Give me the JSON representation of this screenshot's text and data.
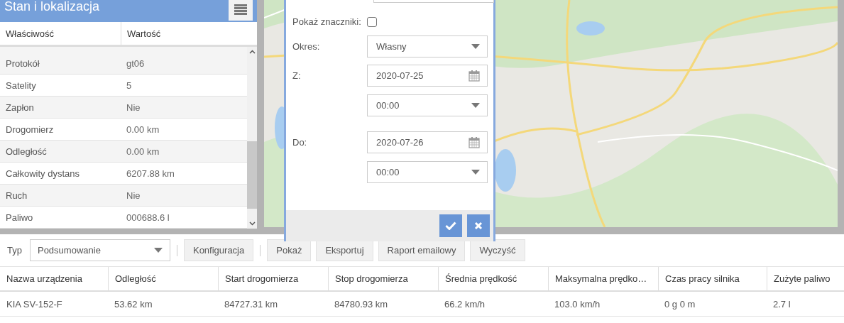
{
  "panel": {
    "title": "Stan i lokalizacja",
    "columns": [
      "Właściwość",
      "Wartość"
    ],
    "rows": [
      {
        "property": "Protokół",
        "value": "gt06"
      },
      {
        "property": "Satelity",
        "value": "5"
      },
      {
        "property": "Zapłon",
        "value": "Nie"
      },
      {
        "property": "Drogomierz",
        "value": "0.00 km"
      },
      {
        "property": "Odległość",
        "value": "0.00 km"
      },
      {
        "property": "Całkowity dystans",
        "value": "6207.88 km"
      },
      {
        "property": "Ruch",
        "value": "Nie"
      },
      {
        "property": "Paliwo",
        "value": "000688.6 l"
      }
    ]
  },
  "dialog": {
    "show_markers": {
      "label": "Pokaż znaczniki:",
      "checked": false
    },
    "period": {
      "label": "Okres:",
      "value": "Własny"
    },
    "from": {
      "label": "Z:",
      "date": "2020-07-25",
      "time": "00:00"
    },
    "to": {
      "label": "Do:",
      "date": "2020-07-26",
      "time": "00:00"
    }
  },
  "toolbar": {
    "type_label": "Typ",
    "type_value": "Podsumowanie",
    "groups": [
      [
        "Konfiguracja"
      ],
      [
        "Pokaż",
        "Eksportuj",
        "Raport emailowy",
        "Wyczyść"
      ]
    ]
  },
  "table": {
    "columns": [
      "Nazwa urządzenia",
      "Odległość",
      "Start drogomierza",
      "Stop drogomierza",
      "Średnia prędkość",
      "Maksymalna prędko…",
      "Czas pracy silnika",
      "Zużyte paliwo"
    ],
    "rows": [
      [
        "KIA SV-152-F",
        "53.62 km",
        "84727.31 km",
        "84780.93 km",
        "66.2 km/h",
        "103.0 km/h",
        "0 g 0 m",
        "2.7 l"
      ]
    ]
  }
}
